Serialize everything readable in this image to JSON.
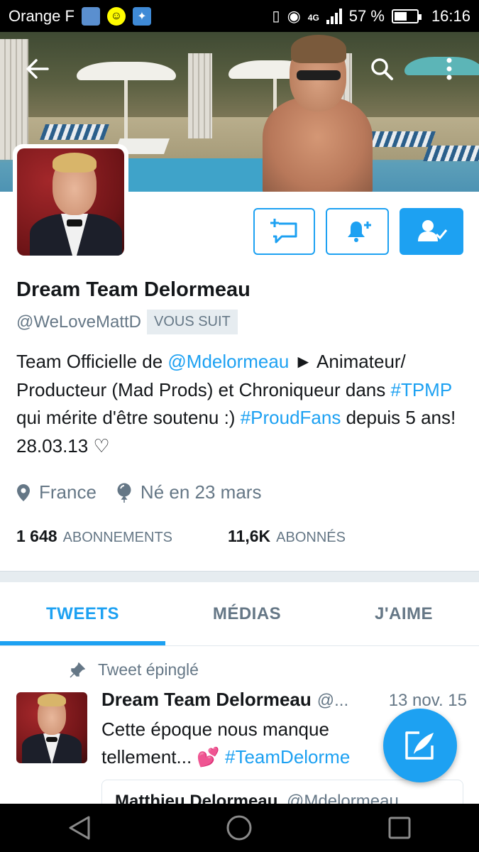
{
  "status_bar": {
    "carrier": "Orange F",
    "network": "4G",
    "battery_percent": "57 %",
    "battery_level": 0.57,
    "time": "16:16"
  },
  "profile": {
    "display_name": "Dream Team Delormeau",
    "handle": "@WeLoveMattD",
    "follows_you_badge": "VOUS SUIT",
    "bio": {
      "part1": "Team Officielle de ",
      "mention": "@Mdelormeau",
      "part2": " ► Animateur/ Producteur (Mad Prods) et Chroniqueur dans ",
      "hashtag1": "#TPMP",
      "part3": " qui mérite d'être soutenu :) ",
      "hashtag2": "#ProudFans",
      "part4": " depuis 5 ans! 28.03.13 ♡"
    },
    "location": "France",
    "birthday": "Né en 23 mars",
    "following_count": "1 648",
    "following_label": "ABONNEMENTS",
    "followers_count": "11,6K",
    "followers_label": "ABONNÉS"
  },
  "tabs": [
    {
      "label": "TWEETS",
      "active": true
    },
    {
      "label": "MÉDIAS",
      "active": false
    },
    {
      "label": "J'AIME",
      "active": false
    }
  ],
  "pinned_tweet": {
    "pinned_label": "Tweet épinglé",
    "author": "Dream Team Delormeau",
    "handle": "@...",
    "date": "13 nov. 15",
    "text_part1": "Cette époque nous manque tellement... ",
    "emoji": "💕",
    "hashtag": " #TeamDelorme",
    "quoted_author": "Matthieu Delormeau",
    "quoted_handle": "@Mdelormeau"
  },
  "colors": {
    "accent": "#1da1f2",
    "secondary_text": "#657786",
    "primary_text": "#14171a"
  },
  "icons": [
    "back-arrow-icon",
    "search-icon",
    "more-vert-icon",
    "message-icon",
    "bell-plus-icon",
    "following-icon",
    "location-pin-icon",
    "balloon-icon",
    "pin-icon",
    "compose-icon",
    "nav-back-icon",
    "nav-home-icon",
    "nav-recents-icon"
  ]
}
